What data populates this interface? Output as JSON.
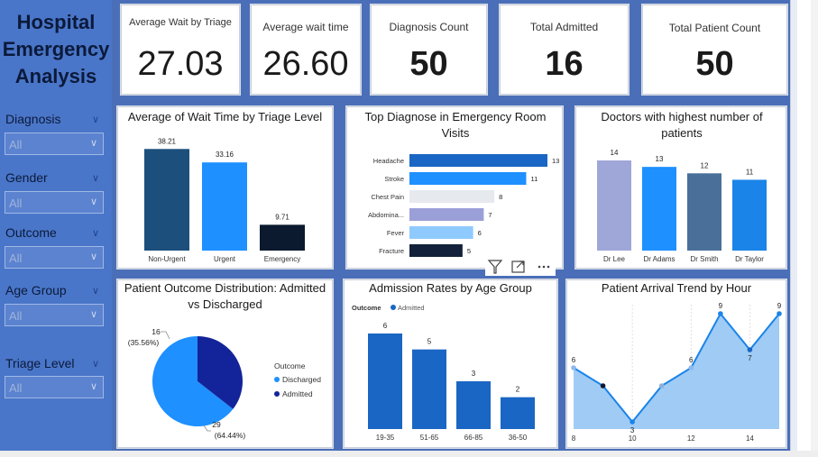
{
  "sidebar": {
    "title_lines": [
      "Hospital",
      "Emergency",
      "Analysis"
    ],
    "filters": [
      {
        "label": "Diagnosis",
        "value": "All"
      },
      {
        "label": "Gender",
        "value": "All"
      },
      {
        "label": "Outcome",
        "value": "All"
      },
      {
        "label": "Age Group",
        "value": "All"
      },
      {
        "label": "Triage Level",
        "value": "All"
      }
    ]
  },
  "kpis": [
    {
      "label": "Average Wait by Triage",
      "value": "27.03"
    },
    {
      "label": "Average wait time",
      "value": "26.60"
    },
    {
      "label": "Diagnosis Count",
      "value": "50"
    },
    {
      "label": "Total Admitted",
      "value": "16"
    },
    {
      "label": "Total Patient Count",
      "value": "50"
    }
  ],
  "colors": {
    "sidebar": "#4a76c9",
    "canvas": "#4a6fb8",
    "dark_navy": "#1c4f7c",
    "bright_blue": "#1e90ff",
    "mid_blue": "#1a66c4"
  },
  "visual_icons": [
    "filter-icon",
    "focus-mode-icon",
    "more-options-icon"
  ],
  "chart_data": [
    {
      "id": "wait_by_triage",
      "type": "bar",
      "title": "Average of Wait Time by Triage Level",
      "categories": [
        "Non-Urgent",
        "Urgent",
        "Emergency"
      ],
      "values": [
        38.21,
        33.16,
        9.71
      ],
      "value_labels": [
        "38.21",
        "33.16",
        "9.71"
      ],
      "colors": [
        "#1c4f7c",
        "#1e90ff",
        "#0b1a2e"
      ],
      "ylim": [
        0,
        40
      ]
    },
    {
      "id": "top_diagnose",
      "type": "bar",
      "orientation": "horizontal",
      "title": "Top Diagnose in Emergency Room Visits",
      "categories": [
        "Headache",
        "Stroke",
        "Chest Pain",
        "Abdomina...",
        "Fever",
        "Fracture"
      ],
      "values": [
        13,
        11,
        8,
        7,
        6,
        5
      ],
      "colors": [
        "#1a66c4",
        "#1e90ff",
        "#e6e9ee",
        "#9b9fd8",
        "#8fcaff",
        "#13223a"
      ],
      "xlim": [
        0,
        13
      ]
    },
    {
      "id": "doctors",
      "type": "bar",
      "title": "Doctors with highest number of patients",
      "categories": [
        "Dr Lee",
        "Dr Adams",
        "Dr Smith",
        "Dr Taylor"
      ],
      "values": [
        14,
        13,
        12,
        11
      ],
      "colors": [
        "#9fa6d8",
        "#1e90ff",
        "#4a7099",
        "#1a84e8"
      ],
      "ylim": [
        0,
        14
      ]
    },
    {
      "id": "outcome_pie",
      "type": "pie",
      "title": "Patient Outcome Distribution: Admitted vs Discharged",
      "legend_title": "Outcome",
      "slices": [
        {
          "name": "Discharged",
          "value": 29,
          "label_count": "29",
          "label_pct": "(64.44%)",
          "color": "#1e90ff"
        },
        {
          "name": "Admitted",
          "value": 16,
          "label_count": "16",
          "label_pct": "(35.56%)",
          "color": "#13249a"
        }
      ]
    },
    {
      "id": "admission_age",
      "type": "bar",
      "title": "Admission Rates by Age Group",
      "legend_title": "Outcome",
      "legend_items": [
        "Admitted"
      ],
      "categories": [
        "19-35",
        "51-65",
        "66-85",
        "36-50"
      ],
      "values": [
        6,
        5,
        3,
        2
      ],
      "color": "#1a66c4",
      "ylim": [
        0,
        6
      ]
    },
    {
      "id": "arrival_hour",
      "type": "area",
      "title": "Patient Arrival Trend by Hour",
      "x": [
        8,
        9,
        10,
        11,
        12,
        13,
        14,
        15
      ],
      "values": [
        6,
        5,
        3,
        5,
        6,
        9,
        7,
        9
      ],
      "x_ticks": [
        "8",
        "10",
        "12",
        "14"
      ],
      "point_labels": [
        "6",
        "",
        "3",
        "",
        "6",
        "9",
        "7",
        "9"
      ],
      "line_color": "#1a84e8",
      "fill_color": "#9fcbf5",
      "ylim": [
        3,
        9
      ]
    }
  ]
}
